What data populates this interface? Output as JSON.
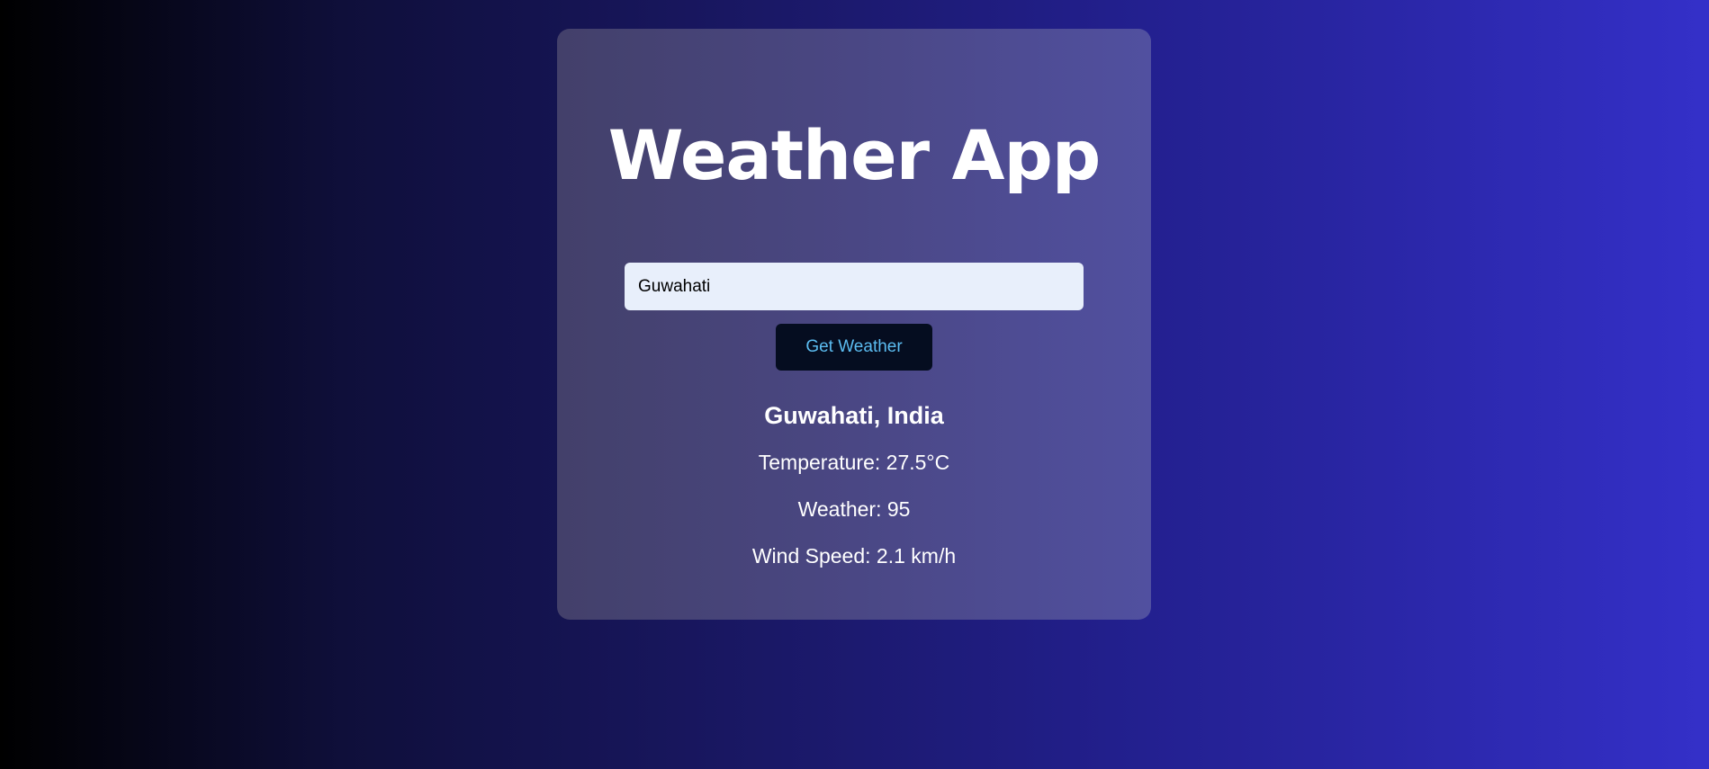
{
  "app": {
    "title": "Weather App"
  },
  "search": {
    "value": "Guwahati",
    "button_label": "Get Weather"
  },
  "result": {
    "location": "Guwahati, India",
    "temperature": "Temperature: 27.5°C",
    "weather": "Weather: 95",
    "wind_speed": "Wind Speed: 2.1 km/h"
  },
  "colors": {
    "button_text": "#5bbcf0",
    "button_bg": "#050d20",
    "input_bg": "#e8effb"
  }
}
